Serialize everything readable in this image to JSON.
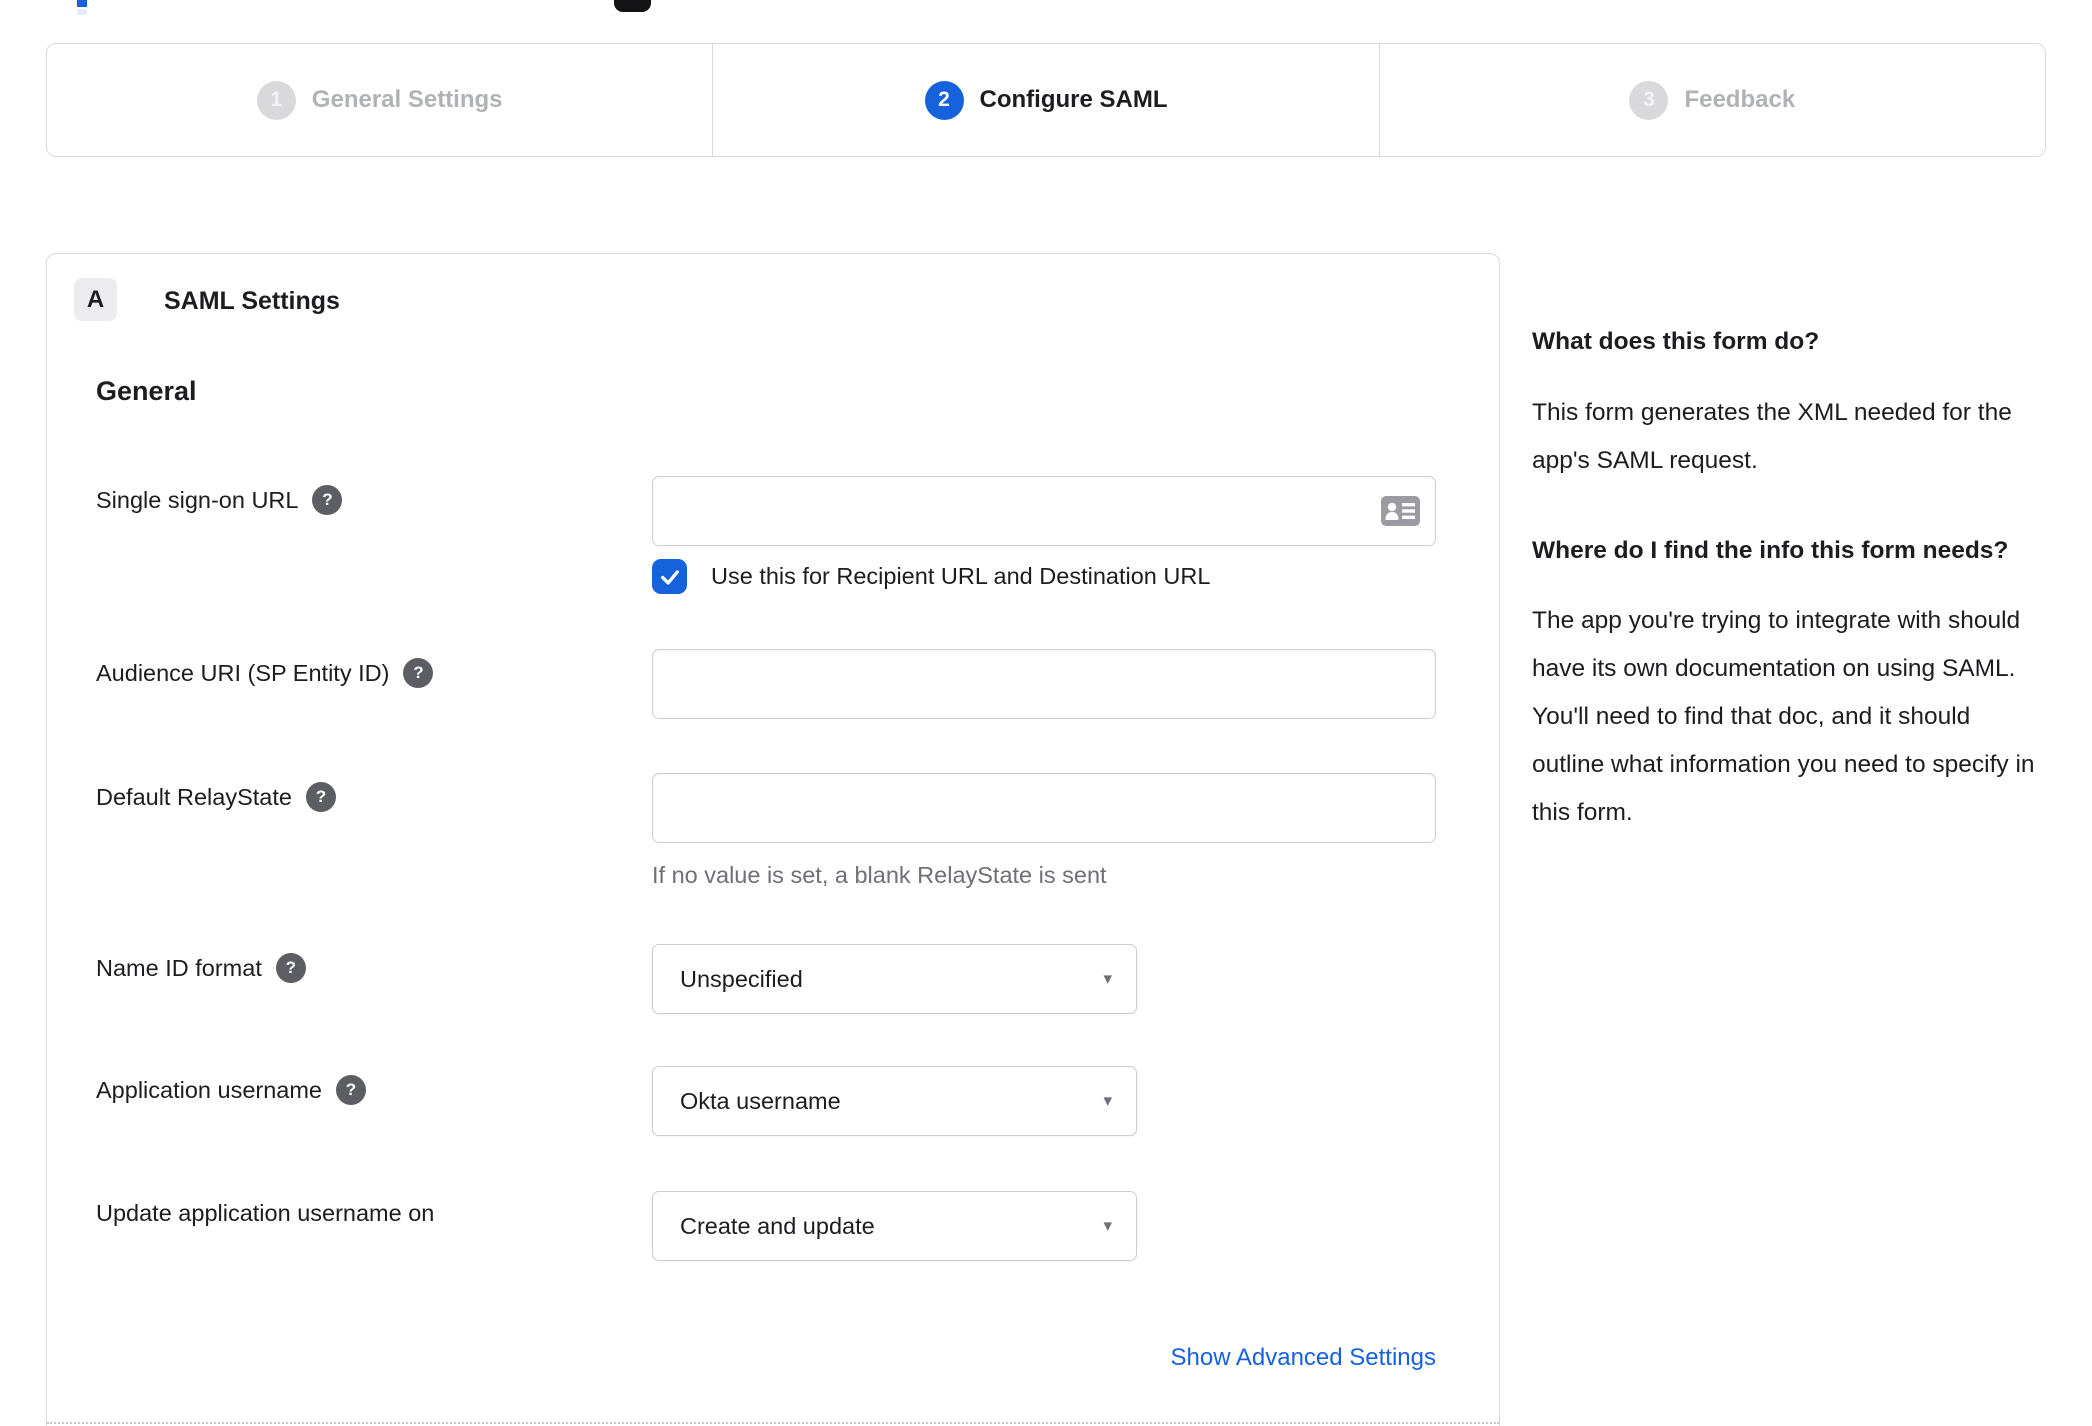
{
  "colors": {
    "accent_blue": "#1662dd",
    "dark_text": "#1d1d21",
    "muted_text": "#6f6f78",
    "inactive_step_text": "#b0b2b6",
    "border": "#d9d9dd"
  },
  "stepper": {
    "steps": [
      {
        "number": "1",
        "label": "General Settings",
        "state": "inactive"
      },
      {
        "number": "2",
        "label": "Configure SAML",
        "state": "active"
      },
      {
        "number": "3",
        "label": "Feedback",
        "state": "inactive"
      }
    ]
  },
  "panel": {
    "badge": "A",
    "title": "SAML Settings",
    "section": "General",
    "sso": {
      "label": "Single sign-on URL",
      "value": "",
      "checkbox_checked": true,
      "checkbox_label": "Use this for Recipient URL and Destination URL"
    },
    "audience": {
      "label": "Audience URI (SP Entity ID)",
      "value": ""
    },
    "relay": {
      "label": "Default RelayState",
      "value": "",
      "hint": "If no value is set, a blank RelayState is sent"
    },
    "name_id": {
      "label": "Name ID format",
      "value": "Unspecified"
    },
    "app_username": {
      "label": "Application username",
      "value": "Okta username"
    },
    "update_username": {
      "label": "Update application username on",
      "value": "Create and update"
    },
    "advanced_link": "Show Advanced Settings"
  },
  "sidebar": {
    "q1": "What does this form do?",
    "a1": "This form generates the XML needed for the app's SAML request.",
    "q2": "Where do I find the info this form needs?",
    "a2": "The app you're trying to integrate with should have its own documentation on using SAML. You'll need to find that doc, and it should outline what information you need to specify in this form."
  },
  "icons": {
    "help": "?",
    "dropdown_arrow": "▾"
  }
}
